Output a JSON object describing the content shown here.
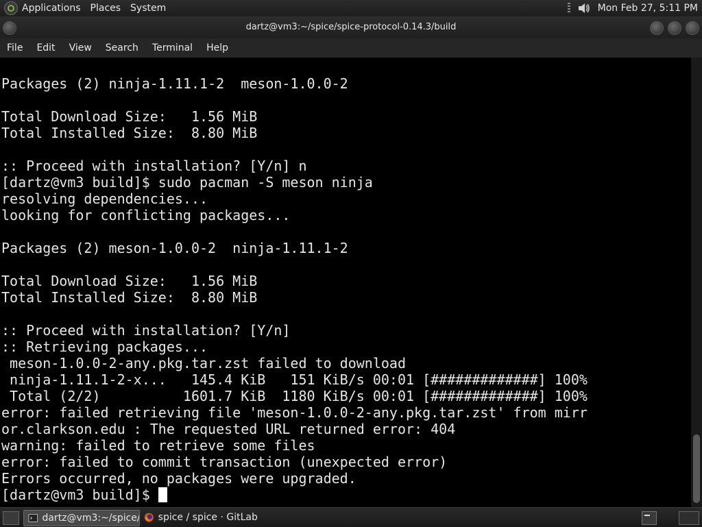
{
  "top_panel": {
    "menus": [
      "Applications",
      "Places",
      "System"
    ],
    "clock": "Mon Feb 27,  5:11 PM"
  },
  "window": {
    "title": "dartz@vm3:~/spice/spice-protocol-0.14.3/build"
  },
  "menubar": {
    "items": [
      "File",
      "Edit",
      "View",
      "Search",
      "Terminal",
      "Help"
    ]
  },
  "terminal": {
    "lines": [
      "Packages (2) ninja-1.11.1-2  meson-1.0.0-2",
      "",
      "Total Download Size:   1.56 MiB",
      "Total Installed Size:  8.80 MiB",
      "",
      ":: Proceed with installation? [Y/n] n",
      "[dartz@vm3 build]$ sudo pacman -S meson ninja",
      "resolving dependencies...",
      "looking for conflicting packages...",
      "",
      "Packages (2) meson-1.0.0-2  ninja-1.11.1-2",
      "",
      "Total Download Size:   1.56 MiB",
      "Total Installed Size:  8.80 MiB",
      "",
      ":: Proceed with installation? [Y/n]",
      ":: Retrieving packages...",
      " meson-1.0.0-2-any.pkg.tar.zst failed to download",
      " ninja-1.11.1-2-x...   145.4 KiB   151 KiB/s 00:01 [#############] 100%",
      " Total (2/2)          1601.7 KiB  1180 KiB/s 00:01 [#############] 100%",
      "error: failed retrieving file 'meson-1.0.0-2-any.pkg.tar.zst' from mirr",
      "or.clarkson.edu : The requested URL returned error: 404",
      "warning: failed to retrieve some files",
      "error: failed to commit transaction (unexpected error)",
      "Errors occurred, no packages were upgraded."
    ],
    "prompt": "[dartz@vm3 build]$ "
  },
  "taskbar": {
    "tasks": [
      {
        "label": "dartz@vm3:~/spice/...",
        "icon": "terminal-icon",
        "active": true
      },
      {
        "label": "spice / spice · GitLab...",
        "icon": "firefox-icon",
        "active": false
      }
    ]
  },
  "colors": {
    "terminal_bg": "#000000",
    "terminal_fg": "#e6e6e6",
    "panel_bg": "#262626"
  }
}
